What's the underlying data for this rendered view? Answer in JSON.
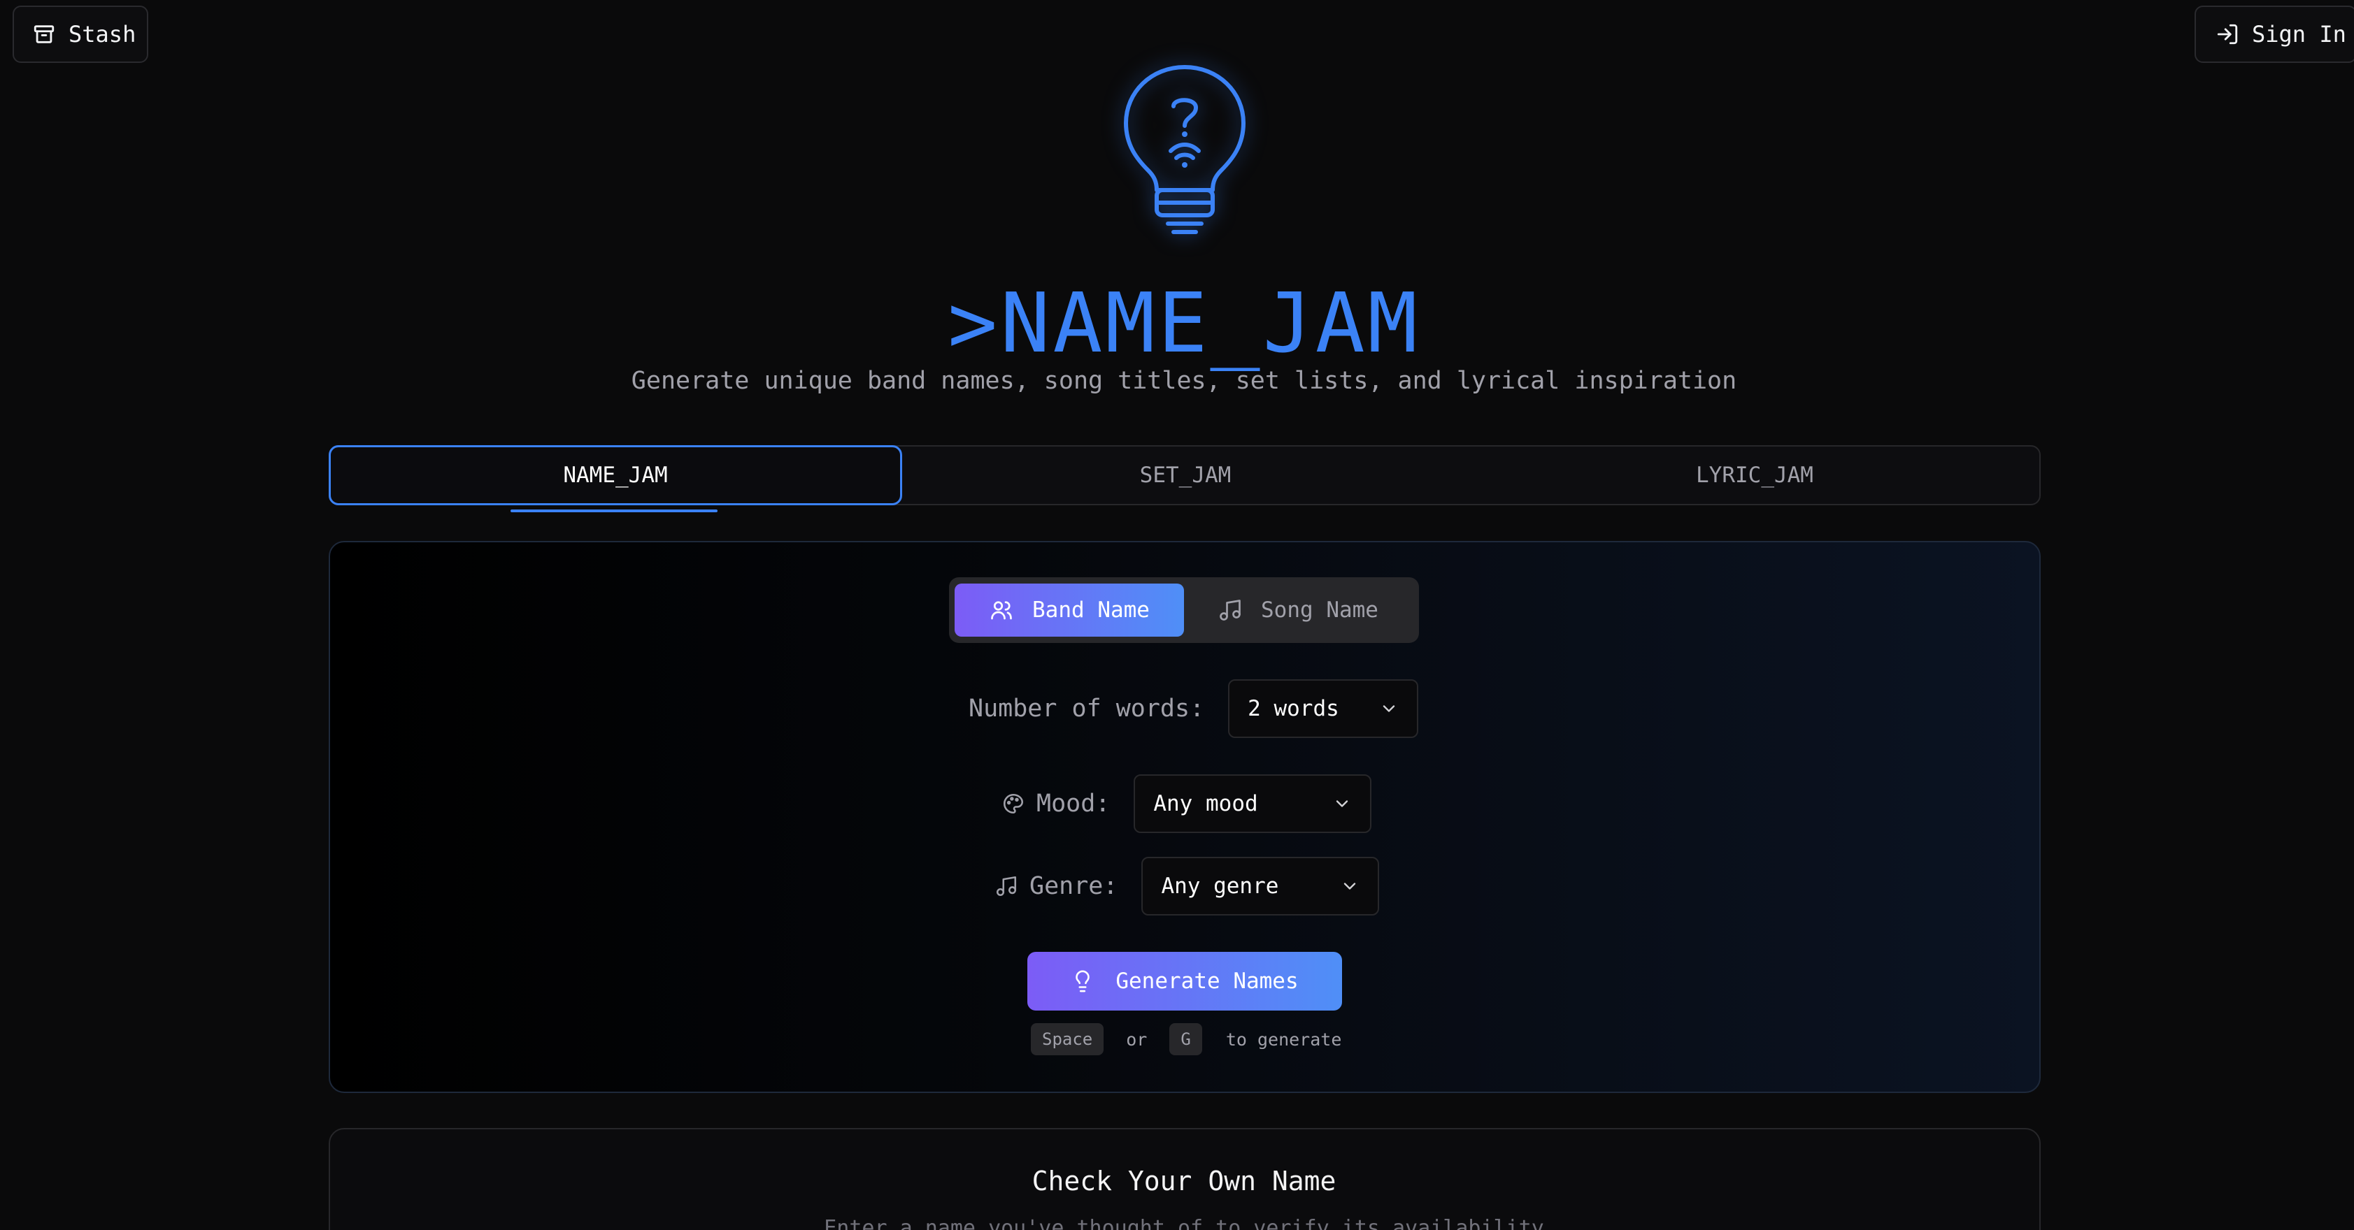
{
  "header": {
    "stash_label": "Stash",
    "signin_label": "Sign In",
    "icons": {
      "stash": "archive-icon",
      "signin": "log-in-icon"
    }
  },
  "hero": {
    "title": ">NAME_JAM",
    "subtitle": "Generate unique band names, song titles, set lists, and lyrical inspiration",
    "logo_icon": "lightbulb-question-icon"
  },
  "tabs": [
    {
      "label": "NAME_JAM",
      "active": true
    },
    {
      "label": "SET_JAM",
      "active": false
    },
    {
      "label": "LYRIC_JAM",
      "active": false
    }
  ],
  "generator": {
    "type_toggle": [
      {
        "label": "Band Name",
        "icon": "users-icon",
        "active": true
      },
      {
        "label": "Song Name",
        "icon": "music-note-icon",
        "active": false
      }
    ],
    "words": {
      "label": "Number of words:",
      "value": "2 words"
    },
    "mood": {
      "label": "Mood:",
      "value": "Any mood",
      "icon": "palette-icon"
    },
    "genre": {
      "label": "Genre:",
      "value": "Any genre",
      "icon": "music-note-icon"
    },
    "generate_label": "Generate Names",
    "hint": {
      "key1": "Space",
      "or": "or",
      "key2": "G",
      "suffix": "to generate"
    }
  },
  "check": {
    "title": "Check Your Own Name",
    "subtitle": "Enter a name you've thought of to verify its availability"
  },
  "colors": {
    "accent": "#3b82f6",
    "gradient_start": "#7c5cf6",
    "gradient_end": "#4f8ff7",
    "background": "#0a0a0b"
  }
}
